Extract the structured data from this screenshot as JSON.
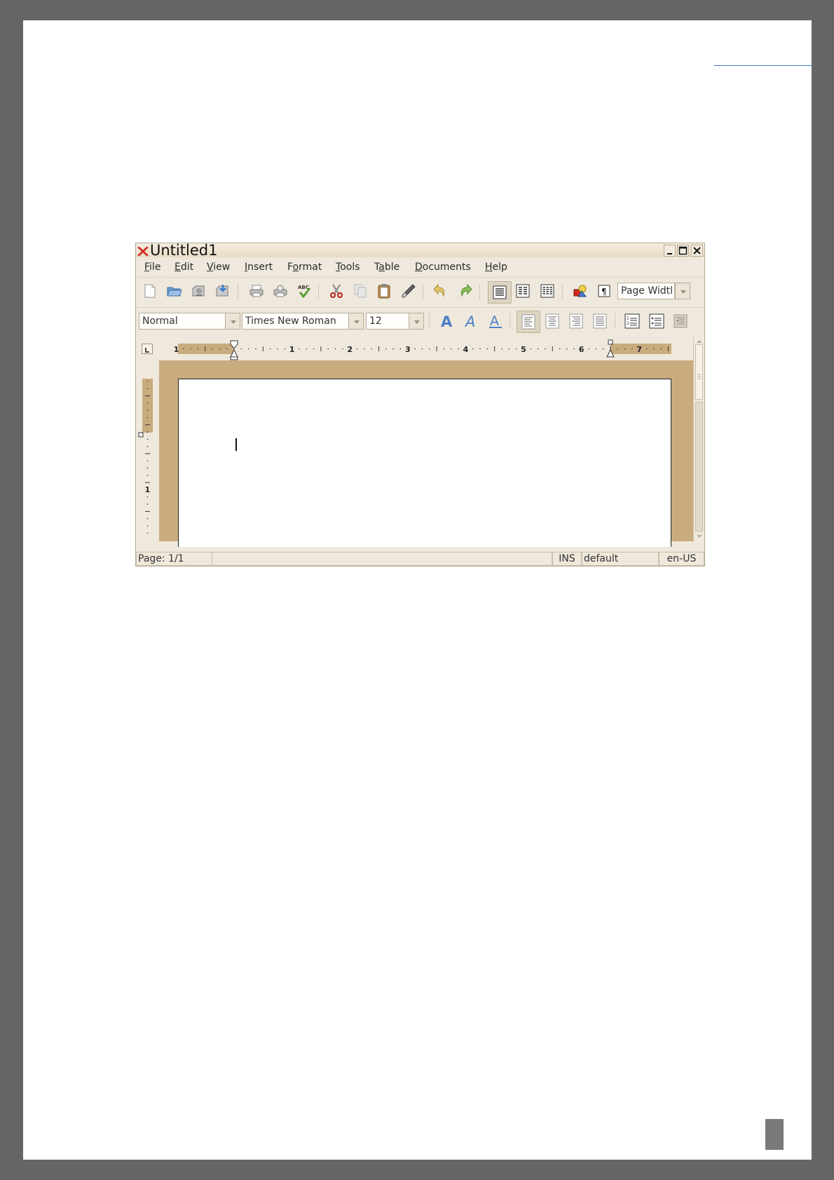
{
  "window": {
    "title": "Untitled1"
  },
  "menu": {
    "items": [
      {
        "label": "File",
        "accel": "F",
        "rest": "ile"
      },
      {
        "label": "Edit",
        "accel": "E",
        "rest": "dit"
      },
      {
        "label": "View",
        "accel": "V",
        "rest": "iew"
      },
      {
        "label": "Insert",
        "accel": "I",
        "rest": "nsert"
      },
      {
        "label": "Format",
        "pre": "F",
        "accel": "o",
        "rest": "rmat"
      },
      {
        "label": "Tools",
        "accel": "T",
        "rest": "ools"
      },
      {
        "label": "Table",
        "pre": "T",
        "accel": "a",
        "rest": "ble"
      },
      {
        "label": "Documents",
        "accel": "D",
        "rest": "ocuments"
      },
      {
        "label": "Help",
        "accel": "H",
        "rest": "elp"
      }
    ]
  },
  "toolbar": {
    "zoom_value": "Page Widtl"
  },
  "format_bar": {
    "style_value": "Normal",
    "font_value": "Times New Roman",
    "size_value": "12"
  },
  "ruler": {
    "h_labels": [
      "1",
      "1",
      "2",
      "3",
      "4",
      "5",
      "6",
      "7"
    ],
    "v_labels": [
      "1"
    ]
  },
  "statusbar": {
    "page": "Page: 1/1",
    "mode": "INS",
    "style": "default",
    "lang": "en-US"
  },
  "colors": {
    "desktop": "#666566",
    "window_bg": "#efe8dc",
    "doc_background": "#c8ac7e",
    "accent_line": "#3f77d2"
  }
}
